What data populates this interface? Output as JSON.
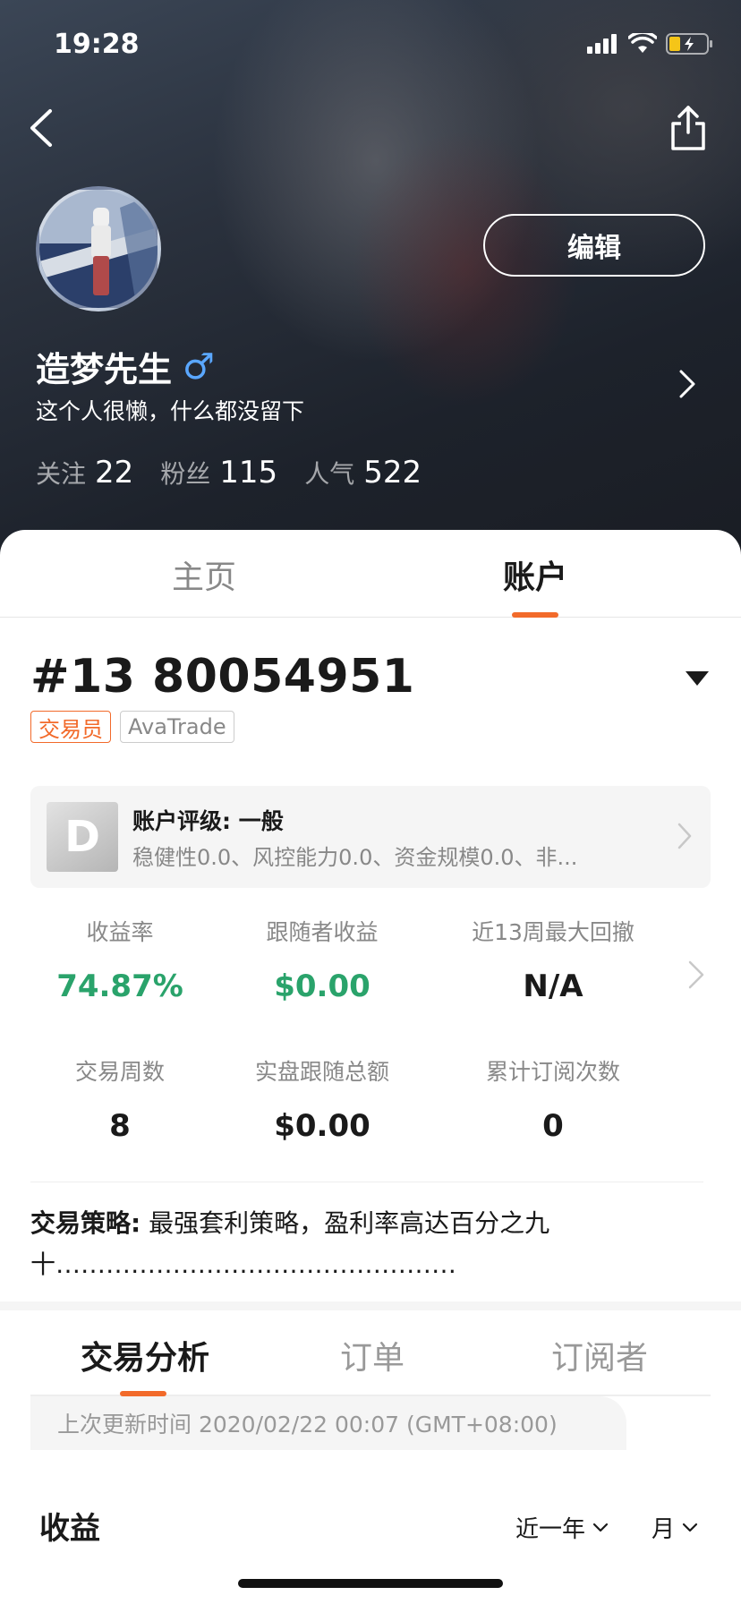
{
  "status_bar": {
    "time": "19:28"
  },
  "profile": {
    "name": "造梦先生",
    "gender_symbol": "♂",
    "bio": "这个人很懒，什么都没留下",
    "edit_label": "编辑",
    "stats": [
      {
        "label": "关注",
        "value": "22"
      },
      {
        "label": "粉丝",
        "value": "115"
      },
      {
        "label": "人气",
        "value": "522"
      }
    ]
  },
  "main_tabs": [
    {
      "label": "主页",
      "active": false
    },
    {
      "label": "账户",
      "active": true
    }
  ],
  "account": {
    "number": "#13 80054951",
    "tags": [
      "交易员",
      "AvaTrade"
    ],
    "rating_badge": "D",
    "rating_title": "账户评级: 一般",
    "rating_desc": "稳健性0.0、风控能力0.0、资金规模0.0、非..."
  },
  "metrics": [
    {
      "label": "收益率",
      "value": "74.87%",
      "color": "#2aa36b"
    },
    {
      "label": "跟随者收益",
      "value": "$0.00",
      "color": "#2aa36b"
    },
    {
      "label": "近13周最大回撤",
      "value": "N/A",
      "color": "#1a1a1a"
    },
    {
      "label": "交易周数",
      "value": "8",
      "color": "#1a1a1a"
    },
    {
      "label": "实盘跟随总额",
      "value": "$0.00",
      "color": "#1a1a1a"
    },
    {
      "label": "累计订阅次数",
      "value": "0",
      "color": "#1a1a1a"
    }
  ],
  "strategy": {
    "label": "交易策略:",
    "text": " 最强套利策略，盈利率高达百分之九十…………………………………………"
  },
  "sub_tabs": [
    {
      "label": "交易分析",
      "active": true
    },
    {
      "label": "订单",
      "active": false
    },
    {
      "label": "订阅者",
      "active": false
    }
  ],
  "update_text": "上次更新时间 2020/02/22 00:07 (GMT+08:00)",
  "earnings": {
    "title": "收益",
    "period_filter": "近一年",
    "unit_filter": "月"
  },
  "colors": {
    "accent": "#f26a2a",
    "positive": "#2aa36b"
  }
}
